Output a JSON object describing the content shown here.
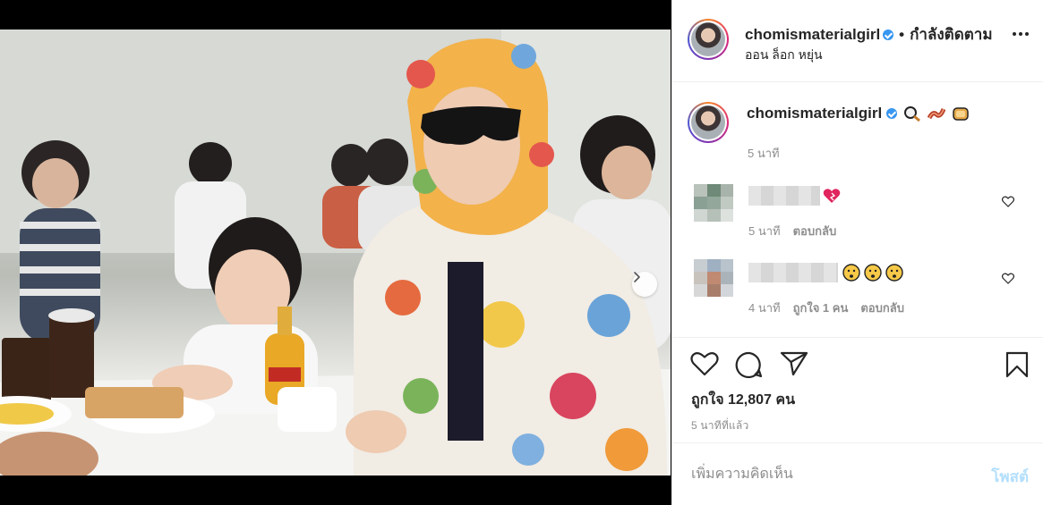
{
  "header": {
    "username": "chomismaterialgirl",
    "separator": "•",
    "follow_status": "กำลังติดตาม",
    "location": "ออน ล็อก หยุ่น"
  },
  "caption": {
    "username": "chomismaterialgirl",
    "emojis": [
      "magnifier-emoji",
      "bacon-emoji",
      "bread-emoji"
    ],
    "time": "5 นาที"
  },
  "comments": [
    {
      "username": "",
      "emoji": "heart-emoji",
      "time": "5 นาที",
      "reply_label": "ตอบกลับ"
    },
    {
      "username": "",
      "emoji": "hushed-face-emoji x3",
      "time": "4 นาที",
      "likes_label": "ถูกใจ 1 คน",
      "reply_label": "ตอบกลับ"
    }
  ],
  "post": {
    "likes_text": "ถูกใจ 12,807 คน",
    "time_ago": "5 นาทีที่แล้ว"
  },
  "add_comment": {
    "placeholder": "เพิ่มความคิดเห็น",
    "post_label": "โพสต์"
  },
  "carousel": {
    "slide_count": 3,
    "active_slide": 1
  },
  "colors": {
    "accent": "#3897f0",
    "post_disabled": "#b2dffc",
    "text": "#262626",
    "muted": "#8e8e8e"
  }
}
